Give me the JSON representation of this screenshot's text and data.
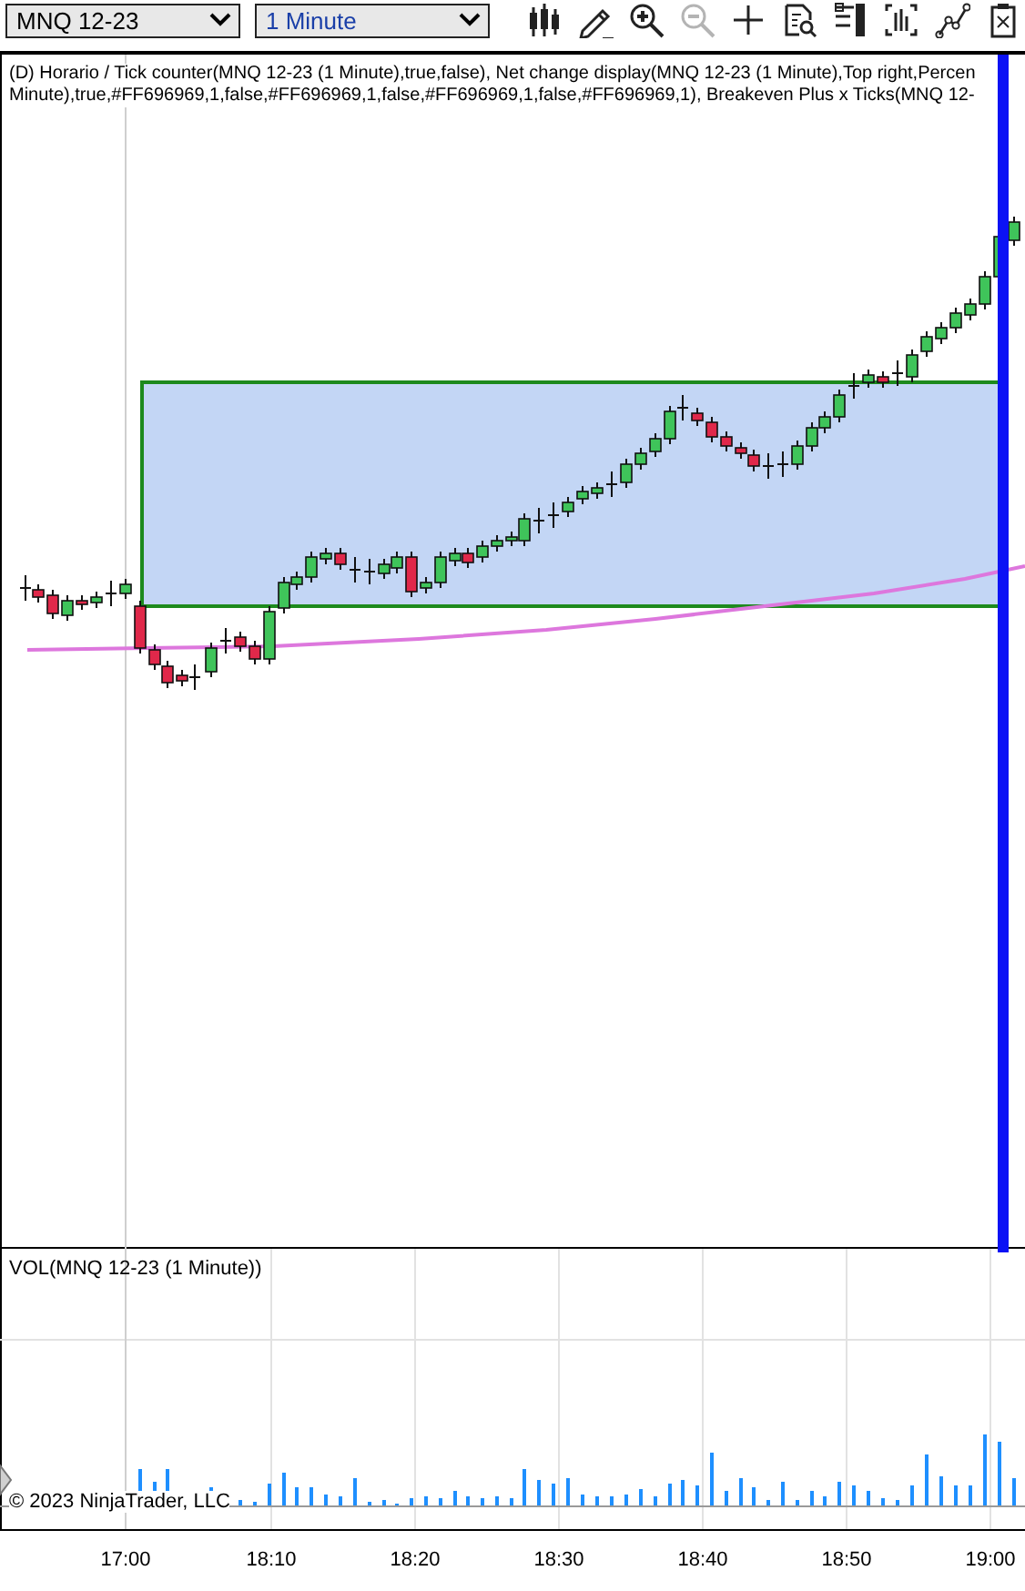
{
  "toolbar": {
    "instrument": "MNQ 12-23",
    "interval": "1 Minute",
    "tools": [
      {
        "kind": "candles",
        "disabled": false
      },
      {
        "kind": "pencil",
        "disabled": false
      },
      {
        "kind": "zoom-in",
        "disabled": false
      },
      {
        "kind": "zoom-out",
        "disabled": true
      },
      {
        "kind": "crosshair",
        "disabled": false
      },
      {
        "kind": "document",
        "disabled": false
      },
      {
        "kind": "panel",
        "disabled": false
      },
      {
        "kind": "bars",
        "disabled": false
      },
      {
        "kind": "line",
        "disabled": false
      },
      {
        "kind": "clipboard",
        "disabled": false
      }
    ]
  },
  "price_panel": {
    "indicator_lines": [
      "(D) Horario / Tick counter(MNQ 12-23 (1 Minute),true,false), Net change display(MNQ 12-23 (1 Minute),Top right,Percen",
      "Minute),true,#FF696969,1,false,#FF696969,1,false,#FF696969,1,false,#FF696969,1), Breakeven Plus x Ticks(MNQ 12-"
    ]
  },
  "volume_panel": {
    "label": "VOL(MNQ 12-23 (1 Minute))",
    "copyright": "© 2023 NinjaTrader, LLC"
  },
  "time_axis": [
    "17:00",
    "18:10",
    "18:20",
    "18:30",
    "18:40",
    "18:50",
    "19:00"
  ]
}
